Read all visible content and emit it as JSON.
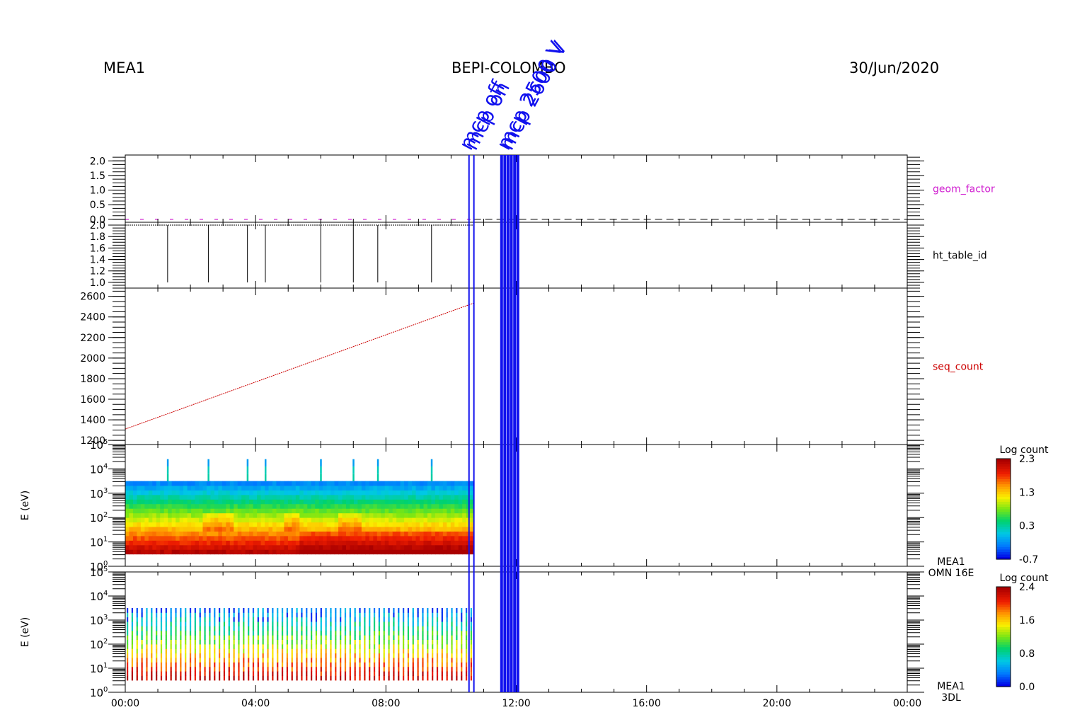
{
  "header": {
    "instrument": "MEA1",
    "mission": "BEPI-COLOMBO",
    "date": "30/Jun/2020"
  },
  "annotations": [
    "mcp off",
    "mcp on",
    "mcp 2500 V",
    "mcp 2600 V"
  ],
  "x_axis": {
    "ticks": [
      "00:00",
      "04:00",
      "08:00",
      "12:00",
      "16:00",
      "20:00",
      "00:00"
    ],
    "range_hours": [
      0,
      24
    ]
  },
  "colors": {
    "annotation": "#1111ee",
    "geom": "#d020d0",
    "seq": "#cc0000",
    "frame": "#000000"
  },
  "chart_data": [
    {
      "type": "line",
      "name": "geom_factor",
      "label": "geom_factor",
      "ylim": [
        -0.1,
        2.2
      ],
      "yticks": [
        "0.0",
        "0.5",
        "1.0",
        "1.5",
        "2.0"
      ],
      "ytick_values": [
        0.0,
        0.5,
        1.0,
        1.5,
        2.0
      ],
      "x": [
        0,
        10.7
      ],
      "y": [
        0.0,
        0.0
      ],
      "fill_line": {
        "value": 0.0,
        "from_hour": 10.7,
        "to_hour": 24,
        "style": "dashed"
      }
    },
    {
      "type": "line",
      "name": "ht_table_id",
      "label": "ht_table_id",
      "ylim": [
        0.9,
        2.05
      ],
      "yticks": [
        "1.0",
        "1.2",
        "1.4",
        "1.6",
        "1.8",
        "2.0"
      ],
      "ytick_values": [
        1.0,
        1.2,
        1.4,
        1.6,
        1.8,
        2.0
      ],
      "baseline": 2.0,
      "baseline_range_hours": [
        0,
        10.7
      ],
      "dips_to": 1.0,
      "dip_hours": [
        1.3,
        2.55,
        3.75,
        4.3,
        6.0,
        7.0,
        7.75,
        9.4
      ]
    },
    {
      "type": "line",
      "name": "seq_count",
      "label": "seq_count",
      "ylim": [
        1160,
        2680
      ],
      "yticks": [
        "1200",
        "1400",
        "1600",
        "1800",
        "2000",
        "2200",
        "2400",
        "2600"
      ],
      "ytick_values": [
        1200,
        1400,
        1600,
        1800,
        2000,
        2200,
        2400,
        2600
      ],
      "x": [
        0,
        10.7
      ],
      "y": [
        1310,
        2535
      ]
    },
    {
      "type": "heatmap",
      "name": "MEA1 OMN 16E",
      "label_lines": [
        "MEA1",
        "OMN 16E"
      ],
      "ylabel": "E (eV)",
      "ylim_log10": [
        0,
        5
      ],
      "yticks_exp": [
        "0",
        "1",
        "2",
        "3",
        "4",
        "5"
      ],
      "data_range_hours": [
        0,
        10.7
      ],
      "energy_range_log10": [
        0.5,
        3.5
      ],
      "spike_hours": [
        1.3,
        2.55,
        3.75,
        4.3,
        6.0,
        7.0,
        7.75,
        9.4
      ],
      "spike_top_log10": 4.4,
      "colorbar": {
        "title": "Log count",
        "max": "2.3",
        "ticks": [
          "2.3",
          "1.3",
          "0.3",
          "-0.7"
        ],
        "tick_values": [
          2.3,
          1.3,
          0.3,
          -0.7
        ],
        "min": -0.7
      }
    },
    {
      "type": "heatmap",
      "name": "MEA1 3DL",
      "label_lines": [
        "MEA1",
        "3DL"
      ],
      "ylabel": "E (eV)",
      "ylim_log10": [
        0,
        5
      ],
      "yticks_exp": [
        "0",
        "1",
        "2",
        "3",
        "4",
        "5"
      ],
      "data_range_hours": [
        0,
        10.7
      ],
      "energy_range_log10": [
        0.5,
        3.5
      ],
      "colorbar": {
        "title": "Log count",
        "max": "2.4",
        "ticks": [
          "2.4",
          "1.6",
          "0.8",
          "0.0"
        ],
        "tick_values": [
          2.4,
          1.6,
          0.8,
          0.0
        ],
        "min": 0.0
      }
    }
  ],
  "event_lines_hours": [
    10.55,
    10.7,
    11.55,
    11.65,
    11.75,
    11.85,
    11.95,
    12.05
  ]
}
